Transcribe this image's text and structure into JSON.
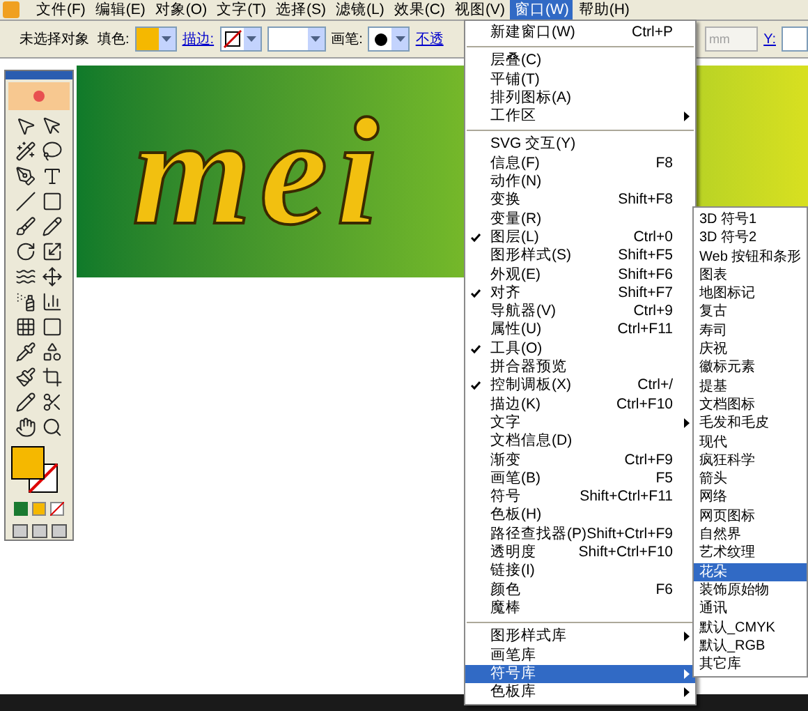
{
  "menubar": [
    {
      "label": "文件(F)",
      "selected": false
    },
    {
      "label": "编辑(E)",
      "selected": false
    },
    {
      "label": "对象(O)",
      "selected": false
    },
    {
      "label": "文字(T)",
      "selected": false
    },
    {
      "label": "选择(S)",
      "selected": false
    },
    {
      "label": "滤镜(L)",
      "selected": false
    },
    {
      "label": "效果(C)",
      "selected": false
    },
    {
      "label": "视图(V)",
      "selected": false
    },
    {
      "label": "窗口(W)",
      "selected": true
    },
    {
      "label": "帮助(H)",
      "selected": false
    }
  ],
  "control_bar": {
    "selection": "未选择对象",
    "fill_label": "填色:",
    "stroke_label": "描边:",
    "brush_label": "画笔:",
    "opacity_link": "不透",
    "unit": "mm",
    "y_label": "Y:"
  },
  "canvas": {
    "artwork_text": "mei"
  },
  "window_menu": [
    {
      "kind": "item",
      "label": "新建窗口(W)",
      "shortcut": "Ctrl+P",
      "checked": false,
      "submenu": false,
      "selected": false
    },
    {
      "kind": "separator"
    },
    {
      "kind": "item",
      "label": "层叠(C)",
      "checked": false,
      "submenu": false,
      "selected": false
    },
    {
      "kind": "item",
      "label": "平铺(T)",
      "checked": false,
      "submenu": false,
      "selected": false
    },
    {
      "kind": "item",
      "label": "排列图标(A)",
      "checked": false,
      "submenu": false,
      "selected": false
    },
    {
      "kind": "item",
      "label": "工作区",
      "checked": false,
      "submenu": true,
      "selected": false
    },
    {
      "kind": "separator"
    },
    {
      "kind": "item",
      "label": "SVG 交互(Y)",
      "checked": false,
      "submenu": false,
      "selected": false
    },
    {
      "kind": "item",
      "label": "信息(F)",
      "shortcut": "F8",
      "checked": false,
      "submenu": false,
      "selected": false
    },
    {
      "kind": "item",
      "label": "动作(N)",
      "checked": false,
      "submenu": false,
      "selected": false
    },
    {
      "kind": "item",
      "label": "变换",
      "shortcut": "Shift+F8",
      "checked": false,
      "submenu": false,
      "selected": false
    },
    {
      "kind": "item",
      "label": "变量(R)",
      "checked": false,
      "submenu": false,
      "selected": false
    },
    {
      "kind": "item",
      "label": "图层(L)",
      "shortcut": "Ctrl+0",
      "checked": true,
      "submenu": false,
      "selected": false
    },
    {
      "kind": "item",
      "label": "图形样式(S)",
      "shortcut": "Shift+F5",
      "checked": false,
      "submenu": false,
      "selected": false
    },
    {
      "kind": "item",
      "label": "外观(E)",
      "shortcut": "Shift+F6",
      "checked": false,
      "submenu": false,
      "selected": false
    },
    {
      "kind": "item",
      "label": "对齐",
      "shortcut": "Shift+F7",
      "checked": true,
      "submenu": false,
      "selected": false
    },
    {
      "kind": "item",
      "label": "导航器(V)",
      "shortcut": "Ctrl+9",
      "checked": false,
      "submenu": false,
      "selected": false
    },
    {
      "kind": "item",
      "label": "属性(U)",
      "shortcut": "Ctrl+F11",
      "checked": false,
      "submenu": false,
      "selected": false
    },
    {
      "kind": "item",
      "label": "工具(O)",
      "checked": true,
      "submenu": false,
      "selected": false
    },
    {
      "kind": "item",
      "label": "拼合器预览",
      "checked": false,
      "submenu": false,
      "selected": false
    },
    {
      "kind": "item",
      "label": "控制调板(X)",
      "shortcut": "Ctrl+/",
      "checked": true,
      "submenu": false,
      "selected": false
    },
    {
      "kind": "item",
      "label": "描边(K)",
      "shortcut": "Ctrl+F10",
      "checked": false,
      "submenu": false,
      "selected": false
    },
    {
      "kind": "item",
      "label": "文字",
      "checked": false,
      "submenu": true,
      "selected": false
    },
    {
      "kind": "item",
      "label": "文档信息(D)",
      "checked": false,
      "submenu": false,
      "selected": false
    },
    {
      "kind": "item",
      "label": "渐变",
      "shortcut": "Ctrl+F9",
      "checked": false,
      "submenu": false,
      "selected": false
    },
    {
      "kind": "item",
      "label": "画笔(B)",
      "shortcut": "F5",
      "checked": false,
      "submenu": false,
      "selected": false
    },
    {
      "kind": "item",
      "label": "符号",
      "shortcut": "Shift+Ctrl+F11",
      "checked": false,
      "submenu": false,
      "selected": false
    },
    {
      "kind": "item",
      "label": "色板(H)",
      "checked": false,
      "submenu": false,
      "selected": false
    },
    {
      "kind": "item",
      "label": "路径查找器(P)",
      "shortcut": "Shift+Ctrl+F9",
      "checked": false,
      "submenu": false,
      "selected": false
    },
    {
      "kind": "item",
      "label": "透明度",
      "shortcut": "Shift+Ctrl+F10",
      "checked": false,
      "submenu": false,
      "selected": false
    },
    {
      "kind": "item",
      "label": "链接(I)",
      "checked": false,
      "submenu": false,
      "selected": false
    },
    {
      "kind": "item",
      "label": "颜色",
      "shortcut": "F6",
      "checked": false,
      "submenu": false,
      "selected": false
    },
    {
      "kind": "item",
      "label": "魔棒",
      "checked": false,
      "submenu": false,
      "selected": false
    },
    {
      "kind": "separator"
    },
    {
      "kind": "item",
      "label": "图形样式库",
      "checked": false,
      "submenu": true,
      "selected": false
    },
    {
      "kind": "item",
      "label": "画笔库",
      "checked": false,
      "submenu": false,
      "selected": false
    },
    {
      "kind": "item",
      "label": "符号库",
      "checked": false,
      "submenu": true,
      "selected": true
    },
    {
      "kind": "item",
      "label": "色板库",
      "checked": false,
      "submenu": true,
      "selected": false
    }
  ],
  "symbol_library_menu": [
    {
      "label": "3D 符号1",
      "selected": false
    },
    {
      "label": "3D 符号2",
      "selected": false
    },
    {
      "label": "Web 按钮和条形",
      "selected": false
    },
    {
      "label": "图表",
      "selected": false
    },
    {
      "label": "地图标记",
      "selected": false
    },
    {
      "label": "复古",
      "selected": false
    },
    {
      "label": "寿司",
      "selected": false
    },
    {
      "label": "庆祝",
      "selected": false
    },
    {
      "label": "徽标元素",
      "selected": false
    },
    {
      "label": "提基",
      "selected": false
    },
    {
      "label": "文档图标",
      "selected": false
    },
    {
      "label": "毛发和毛皮",
      "selected": false
    },
    {
      "label": "现代",
      "selected": false
    },
    {
      "label": "疯狂科学",
      "selected": false
    },
    {
      "label": "箭头",
      "selected": false
    },
    {
      "label": "网络",
      "selected": false
    },
    {
      "label": "网页图标",
      "selected": false
    },
    {
      "label": "自然界",
      "selected": false
    },
    {
      "label": "艺术纹理",
      "selected": false
    },
    {
      "label": "花朵",
      "selected": true
    },
    {
      "label": "装饰原始物",
      "selected": false
    },
    {
      "label": "通讯",
      "selected": false
    },
    {
      "label": "默认_CMYK",
      "selected": false
    },
    {
      "label": "默认_RGB",
      "selected": false
    },
    {
      "label": "其它库",
      "selected": false
    }
  ]
}
